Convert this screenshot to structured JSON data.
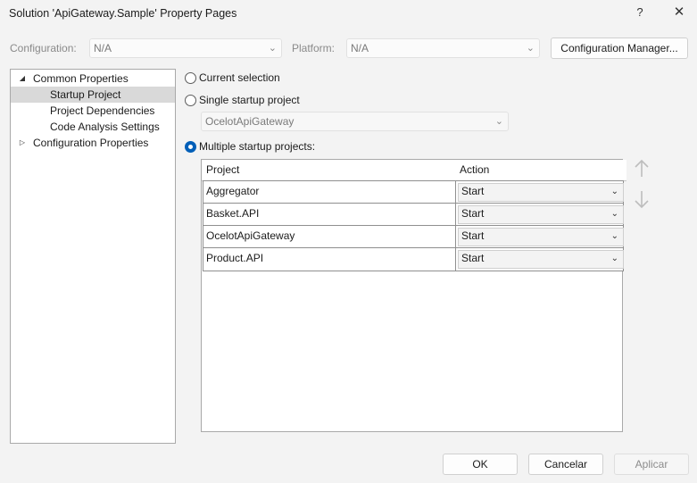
{
  "window": {
    "title": "Solution 'ApiGateway.Sample' Property Pages",
    "help_label": "?",
    "close_label": "✕"
  },
  "toolbar": {
    "configuration_label": "Configuration:",
    "configuration_value": "N/A",
    "platform_label": "Platform:",
    "platform_value": "N/A",
    "config_manager_button": "Configuration Manager..."
  },
  "tree": {
    "items": [
      {
        "label": "Common Properties",
        "expanded": true
      },
      {
        "label": "Startup Project",
        "selected": true
      },
      {
        "label": "Project Dependencies"
      },
      {
        "label": "Code Analysis Settings"
      },
      {
        "label": "Configuration Properties",
        "expanded": false
      }
    ]
  },
  "startup": {
    "current_selection_label": "Current selection",
    "single_label": "Single startup project",
    "single_value": "OcelotApiGateway",
    "multiple_label": "Multiple startup projects:",
    "selected_option": "multiple"
  },
  "grid": {
    "columns": [
      "Project",
      "Action"
    ],
    "rows": [
      {
        "project": "Aggregator",
        "action": "Start"
      },
      {
        "project": "Basket.API",
        "action": "Start"
      },
      {
        "project": "OcelotApiGateway",
        "action": "Start"
      },
      {
        "project": "Product.API",
        "action": "Start"
      }
    ],
    "move_up_icon": "arrow-up-icon",
    "move_down_icon": "arrow-down-icon"
  },
  "footer": {
    "ok_label": "OK",
    "cancel_label": "Cancelar",
    "apply_label": "Aplicar"
  },
  "colors": {
    "accent": "#005fb8",
    "background": "#f3f3f3",
    "selection": "#d9d9d9"
  }
}
